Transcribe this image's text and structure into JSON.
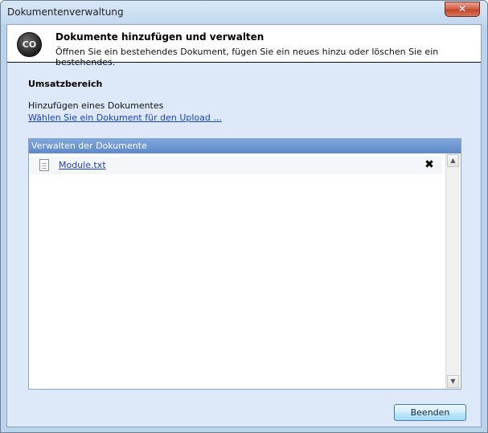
{
  "window": {
    "title": "Dokumentenverwaltung",
    "close_glyph": "✕"
  },
  "header": {
    "logo_text": "CO",
    "title": "Dokumente hinzufügen und verwalten",
    "subtitle": "Öffnen Sie ein bestehendes Dokument, fügen Sie ein neues hinzu oder löschen Sie ein bestehendes."
  },
  "section": {
    "title": "Umsatzbereich",
    "add_label": "Hinzufügen eines Dokumentes",
    "upload_link": "Wählen Sie ein Dokument für den Upload ..."
  },
  "documents_panel": {
    "header": "Verwalten der Dokumente",
    "items": [
      {
        "name": "Module.txt",
        "icon": "text-file-icon",
        "delete_glyph": "✖"
      }
    ]
  },
  "scrollbar": {
    "up_glyph": "▲",
    "down_glyph": "▼"
  },
  "footer": {
    "finish_label": "Beenden"
  },
  "colors": {
    "link": "#1a3fbf",
    "panel_header": "#6f98d4",
    "client_background": "#dde9f8"
  }
}
